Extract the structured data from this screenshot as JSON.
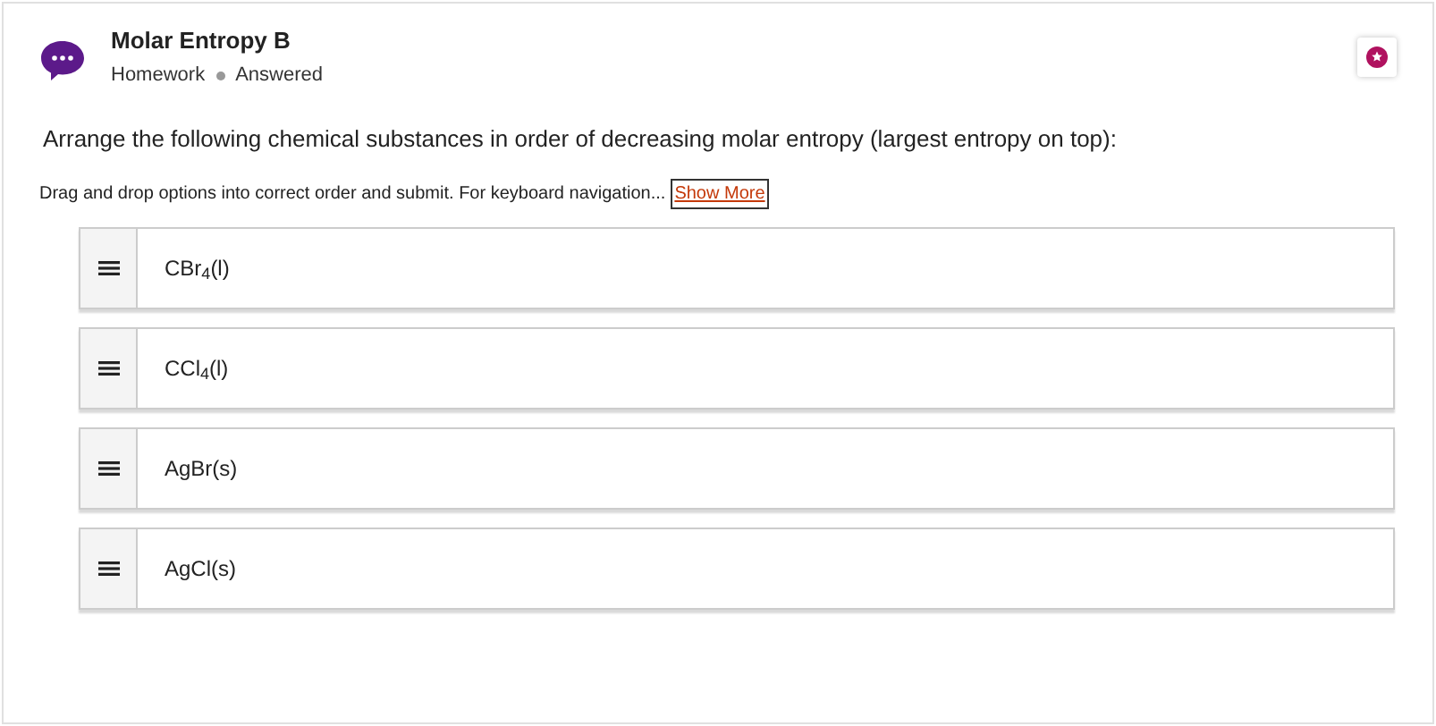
{
  "header": {
    "title": "Molar Entropy B",
    "category": "Homework",
    "status": "Answered"
  },
  "question": "Arrange the following chemical substances in order of decreasing molar entropy (largest entropy on top):",
  "instructions": "Drag and drop options into correct order and submit. For keyboard navigation...",
  "show_more": {
    "label": "Show More",
    "focused": true
  },
  "options": [
    {
      "label": "CBr$_{4}$(l)"
    },
    {
      "label": "CCl$_{4}$(l)"
    },
    {
      "label": "AgBr(s)"
    },
    {
      "label": "AgCl(s)"
    }
  ]
}
